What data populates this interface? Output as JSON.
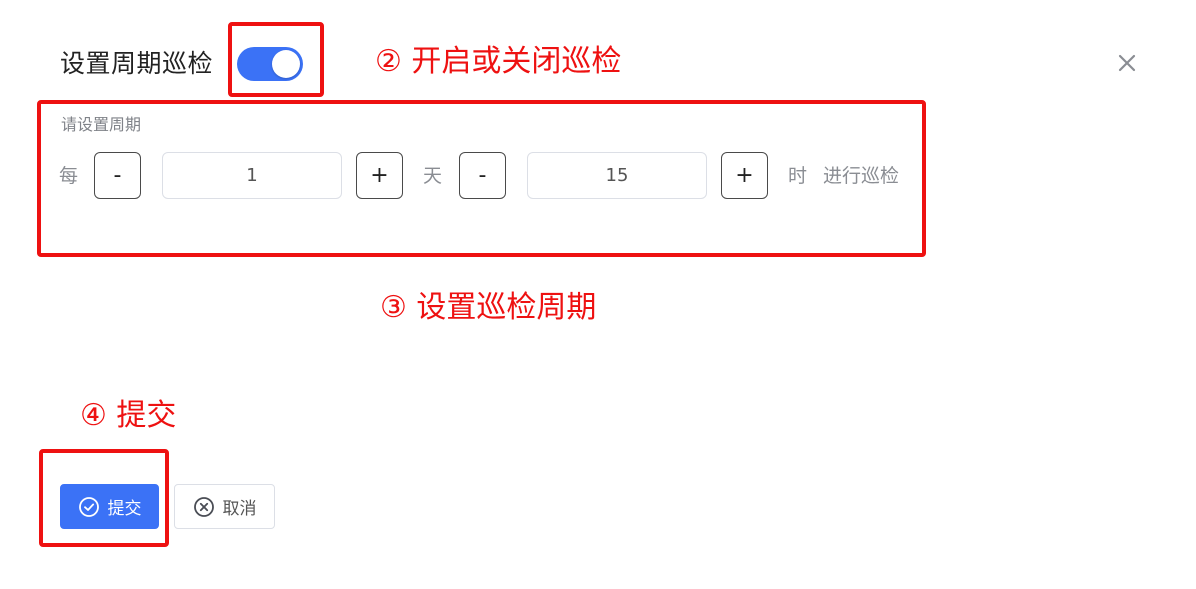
{
  "header": {
    "title": "设置周期巡检",
    "toggle_on": true
  },
  "period": {
    "hint": "请设置周期",
    "prefix": "每",
    "days": {
      "value": "1",
      "minus": "-",
      "plus": "+",
      "unit": "天"
    },
    "hours": {
      "value": "15",
      "minus": "-",
      "plus": "+",
      "unit": "时"
    },
    "suffix": "进行巡检"
  },
  "footer": {
    "submit_label": "提交",
    "cancel_label": "取消"
  },
  "annotations": {
    "toggle": "② 开启或关闭巡检",
    "period": "③ 设置巡检周期",
    "submit": "④ 提交"
  },
  "colors": {
    "primary": "#3b72f6",
    "annotation": "#ee1111"
  },
  "icons": {
    "close": "close-icon",
    "submit": "check-circle-icon",
    "cancel": "close-circle-icon"
  }
}
